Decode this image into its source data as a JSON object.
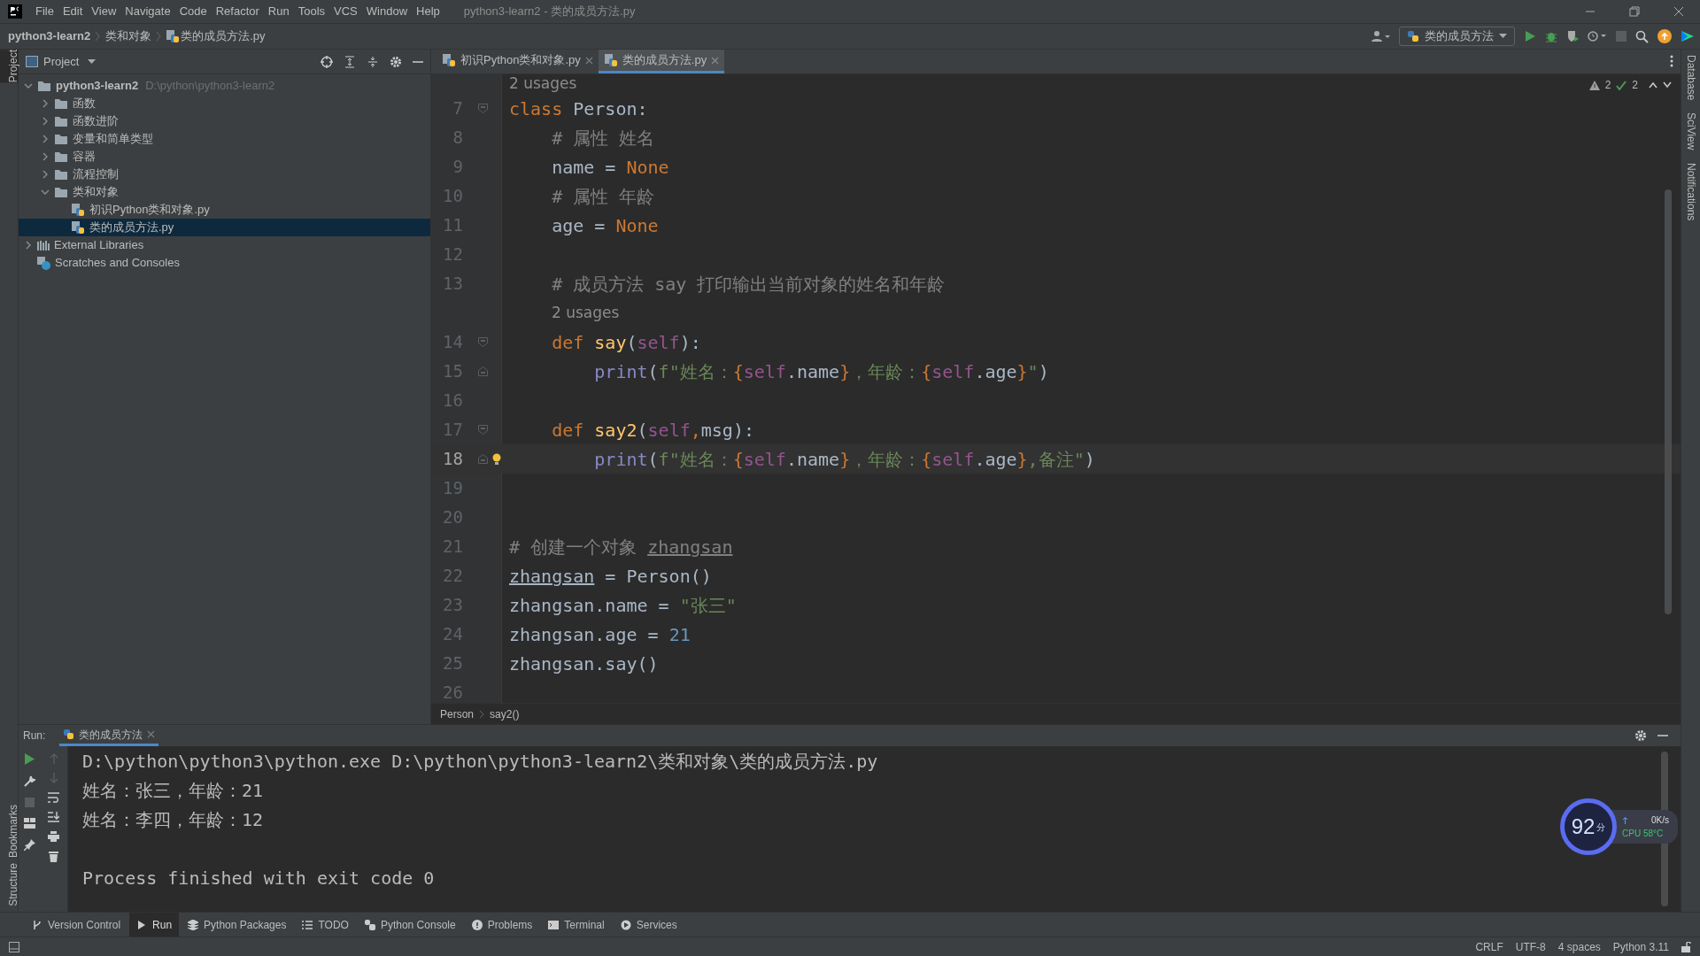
{
  "menu_bar": {
    "items": [
      "File",
      "Edit",
      "View",
      "Navigate",
      "Code",
      "Refactor",
      "Run",
      "Tools",
      "VCS",
      "Window",
      "Help"
    ],
    "title": "python3-learn2 - 类的成员方法.py"
  },
  "nav_bar": {
    "breadcrumbs": [
      {
        "label": "python3-learn2",
        "kind": "project"
      },
      {
        "label": "类和对象",
        "kind": "folder"
      },
      {
        "label": "类的成员方法.py",
        "kind": "python-file"
      }
    ],
    "run_config": "类的成员方法"
  },
  "left_strip": {
    "top": [
      {
        "label": "Project",
        "selected": true
      }
    ],
    "bottom": [
      {
        "label": "Bookmarks",
        "selected": false
      },
      {
        "label": "Structure",
        "selected": false
      }
    ]
  },
  "right_strip": [
    "Database",
    "SciView",
    "Notifications"
  ],
  "project": {
    "title": "Project",
    "tree": [
      {
        "label": "python3-learn2",
        "path": "D:\\python\\python3-learn2",
        "kind": "project",
        "expanded": true,
        "selected": false,
        "children": [
          {
            "label": "函数",
            "kind": "folder",
            "expanded": false,
            "selected": false
          },
          {
            "label": "函数进阶",
            "kind": "folder",
            "expanded": false,
            "selected": false
          },
          {
            "label": "变量和简单类型",
            "kind": "folder",
            "expanded": false,
            "selected": false
          },
          {
            "label": "容器",
            "kind": "folder",
            "expanded": false,
            "selected": false
          },
          {
            "label": "流程控制",
            "kind": "folder",
            "expanded": false,
            "selected": false
          },
          {
            "label": "类和对象",
            "kind": "folder",
            "expanded": true,
            "selected": false,
            "children": [
              {
                "label": "初识Python类和对象.py",
                "kind": "python-file",
                "selected": false
              },
              {
                "label": "类的成员方法.py",
                "kind": "python-file",
                "selected": true
              }
            ]
          }
        ]
      },
      {
        "label": "External Libraries",
        "kind": "libraries",
        "expanded": false,
        "selected": false
      },
      {
        "label": "Scratches and Consoles",
        "kind": "scratches",
        "selected": false
      }
    ]
  },
  "editor": {
    "tabs": [
      {
        "label": "初识Python类和对象.py",
        "selected": false
      },
      {
        "label": "类的成员方法.py",
        "selected": true
      }
    ],
    "inspections": {
      "warnings": "2",
      "weak_warnings": "2"
    },
    "lines": [
      {
        "kind": "hint",
        "text": "2 usages"
      },
      {
        "kind": "code",
        "number": "7",
        "fold": {
          "kind": "start"
        },
        "current": false,
        "tokens": [
          {
            "t": "class ",
            "kind": "keyword"
          },
          {
            "t": "Person:",
            "kind": "plain"
          }
        ]
      },
      {
        "kind": "code",
        "number": "8",
        "current": false,
        "tokens": [
          {
            "t": "    # 属性 姓名",
            "kind": "comment"
          }
        ]
      },
      {
        "kind": "code",
        "number": "9",
        "current": false,
        "tokens": [
          {
            "t": "    name = ",
            "kind": "plain"
          },
          {
            "t": "None",
            "kind": "keyword"
          }
        ]
      },
      {
        "kind": "code",
        "number": "10",
        "current": false,
        "tokens": [
          {
            "t": "    # 属性 年龄",
            "kind": "comment"
          }
        ]
      },
      {
        "kind": "code",
        "number": "11",
        "current": false,
        "tokens": [
          {
            "t": "    age = ",
            "kind": "plain"
          },
          {
            "t": "None",
            "kind": "keyword"
          }
        ]
      },
      {
        "kind": "code",
        "number": "12",
        "current": false
      },
      {
        "kind": "code",
        "number": "13",
        "current": false,
        "tokens": [
          {
            "t": "    # 成员方法 say 打印输出当前对象的姓名和年龄",
            "kind": "comment"
          }
        ]
      },
      {
        "kind": "hint",
        "text": "2 usages"
      },
      {
        "kind": "code",
        "number": "14",
        "fold": {
          "kind": "start"
        },
        "current": false,
        "tokens": [
          {
            "t": "    def ",
            "kind": "keyword"
          },
          {
            "t": "say",
            "kind": "function"
          },
          {
            "t": "(",
            "kind": "plain"
          },
          {
            "t": "self",
            "kind": "self"
          },
          {
            "t": "):",
            "kind": "plain"
          }
        ]
      },
      {
        "kind": "code",
        "number": "15",
        "fold": {
          "kind": "end"
        },
        "current": false,
        "tokens": [
          {
            "t": "        print",
            "kind": "builtin"
          },
          {
            "t": "(",
            "kind": "plain"
          },
          {
            "t": "f\"姓名：",
            "kind": "string"
          },
          {
            "t": "{",
            "kind": "keyword"
          },
          {
            "t": "self",
            "kind": "self"
          },
          {
            "t": ".name",
            "kind": "plain"
          },
          {
            "t": "}",
            "kind": "keyword"
          },
          {
            "t": "，年龄：",
            "kind": "string"
          },
          {
            "t": "{",
            "kind": "keyword"
          },
          {
            "t": "self",
            "kind": "self"
          },
          {
            "t": ".age",
            "kind": "plain"
          },
          {
            "t": "}",
            "kind": "keyword"
          },
          {
            "t": "\"",
            "kind": "string"
          },
          {
            "t": ")",
            "kind": "plain"
          }
        ]
      },
      {
        "kind": "code",
        "number": "16",
        "current": false
      },
      {
        "kind": "code",
        "number": "17",
        "fold": {
          "kind": "start"
        },
        "current": false,
        "tokens": [
          {
            "t": "    def ",
            "kind": "keyword"
          },
          {
            "t": "say2",
            "kind": "function"
          },
          {
            "t": "(",
            "kind": "plain"
          },
          {
            "t": "self",
            "kind": "self"
          },
          {
            "t": ",",
            "kind": "keyword"
          },
          {
            "t": "msg",
            "kind": "param"
          },
          {
            "t": "):",
            "kind": "plain"
          }
        ]
      },
      {
        "kind": "code",
        "number": "18",
        "fold": {
          "kind": "end"
        },
        "current": true,
        "bulb": true,
        "tokens": [
          {
            "t": "        print",
            "kind": "builtin"
          },
          {
            "t": "(",
            "kind": "plain"
          },
          {
            "t": "f\"姓名：",
            "kind": "string"
          },
          {
            "t": "{",
            "kind": "keyword"
          },
          {
            "t": "self",
            "kind": "self"
          },
          {
            "t": ".name",
            "kind": "plain"
          },
          {
            "t": "}",
            "kind": "keyword"
          },
          {
            "t": "，年龄：",
            "kind": "string"
          },
          {
            "t": "{",
            "kind": "keyword"
          },
          {
            "t": "self",
            "kind": "self"
          },
          {
            "t": ".age",
            "kind": "plain"
          },
          {
            "t": "}",
            "kind": "keyword"
          },
          {
            "t": ",备注\"",
            "kind": "string"
          },
          {
            "t": ")",
            "kind": "plain"
          }
        ]
      },
      {
        "kind": "code",
        "number": "19",
        "current": false
      },
      {
        "kind": "code",
        "number": "20",
        "current": false
      },
      {
        "kind": "code",
        "number": "21",
        "current": false,
        "tokens": [
          {
            "t": "# 创建一个对象 ",
            "kind": "comment"
          },
          {
            "t": "zhangsan",
            "kind": "comment-typo"
          }
        ]
      },
      {
        "kind": "code",
        "number": "22",
        "current": false,
        "tokens": [
          {
            "t": "zhangsan",
            "kind": "typo"
          },
          {
            "t": " = Person()",
            "kind": "plain"
          }
        ]
      },
      {
        "kind": "code",
        "number": "23",
        "current": false,
        "tokens": [
          {
            "t": "zhangsan.name = ",
            "kind": "plain"
          },
          {
            "t": "\"张三\"",
            "kind": "string"
          }
        ]
      },
      {
        "kind": "code",
        "number": "24",
        "current": false,
        "tokens": [
          {
            "t": "zhangsan.age = ",
            "kind": "plain"
          },
          {
            "t": "21",
            "kind": "number"
          }
        ]
      },
      {
        "kind": "code",
        "number": "25",
        "current": false,
        "tokens": [
          {
            "t": "zhangsan.say()",
            "kind": "plain"
          }
        ]
      },
      {
        "kind": "code",
        "number": "26",
        "current": false
      }
    ],
    "breadcrumbs": [
      "Person",
      "say2()"
    ]
  },
  "run_panel": {
    "label": "Run:",
    "tab": "类的成员方法",
    "output": [
      {
        "text": "D:\\python\\python3\\python.exe D:\\python\\python3-learn2\\类和对象\\类的成员方法.py"
      },
      {
        "text": "姓名：张三，年龄：21"
      },
      {
        "text": "姓名：李四，年龄：12"
      },
      {
        "kind": "blank"
      },
      {
        "text": "Process finished with exit code 0"
      }
    ]
  },
  "tool_windows": [
    {
      "label": "Version Control",
      "kind": "vcs",
      "selected": false
    },
    {
      "label": "Run",
      "kind": "run",
      "selected": true
    },
    {
      "label": "Python Packages",
      "kind": "packages",
      "selected": false
    },
    {
      "label": "TODO",
      "kind": "todo",
      "selected": false
    },
    {
      "label": "Python Console",
      "kind": "console",
      "selected": false
    },
    {
      "label": "Problems",
      "kind": "problems",
      "selected": false
    },
    {
      "label": "Terminal",
      "kind": "terminal",
      "selected": false
    },
    {
      "label": "Services",
      "kind": "services",
      "selected": false
    }
  ],
  "status_bar": [
    "CRLF",
    "UTF-8",
    "4 spaces",
    "Python 3.11"
  ],
  "monitor_widget": {
    "score": "92",
    "unit": "分",
    "speed": "0K/s",
    "cpu": "CPU 58°C"
  }
}
